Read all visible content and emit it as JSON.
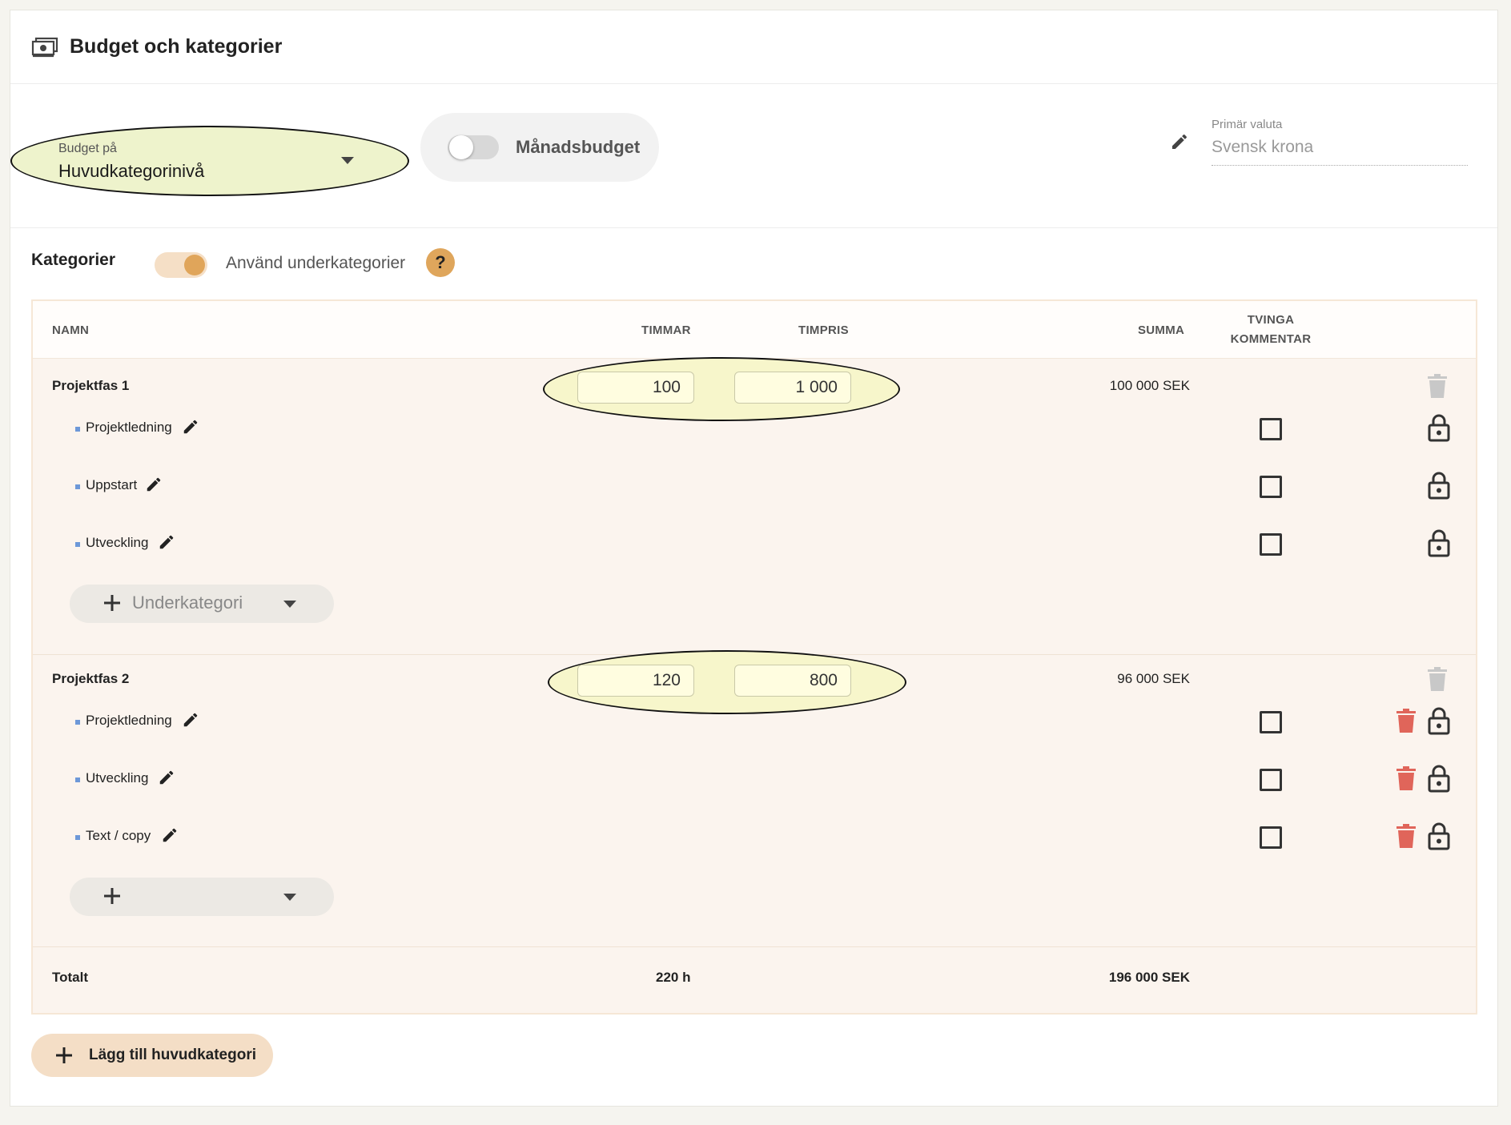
{
  "header": {
    "title": "Budget och kategorier",
    "icon": "money-icon"
  },
  "settings": {
    "budget_on_label": "Budget på",
    "budget_on_value": "Huvudkategorinivå",
    "monthly_budget_label": "Månadsbudget",
    "monthly_budget_enabled": false,
    "currency_label": "Primär valuta",
    "currency_value": "Svensk krona"
  },
  "categories": {
    "title": "Kategorier",
    "use_subcategories_label": "Använd underkategorier",
    "use_subcategories_enabled": true,
    "help_symbol": "?"
  },
  "table": {
    "headers": {
      "name": "NAMN",
      "hours": "TIMMAR",
      "rate": "TIMPRIS",
      "sum": "SUMMA",
      "force_comment_1": "TVINGA",
      "force_comment_2": "KOMMENTAR"
    },
    "groups": [
      {
        "name": "Projektfas 1",
        "hours": "100",
        "rate": "1 000",
        "sum": "100 000 SEK",
        "subcategories": [
          {
            "name": "Projektledning",
            "force_comment": false,
            "deletable": false
          },
          {
            "name": "Uppstart",
            "force_comment": false,
            "deletable": false
          },
          {
            "name": "Utveckling",
            "force_comment": false,
            "deletable": false
          }
        ],
        "add_sub_label": "Underkategori"
      },
      {
        "name": "Projektfas 2",
        "hours": "120",
        "rate": "800",
        "sum": "96 000 SEK",
        "subcategories": [
          {
            "name": "Projektledning",
            "force_comment": false,
            "deletable": true
          },
          {
            "name": "Utveckling",
            "force_comment": false,
            "deletable": true
          },
          {
            "name": "Text / copy",
            "force_comment": false,
            "deletable": true
          }
        ],
        "add_sub_label": ""
      }
    ],
    "total": {
      "label": "Totalt",
      "hours": "220 h",
      "sum": "196 000 SEK"
    }
  },
  "add_main_label": "Lägg till huvudkategori",
  "colors": {
    "accent": "#e0a55a",
    "accent_light": "#f4dec6",
    "table_bg": "#fbf4ee",
    "delete_red": "#e0655a",
    "bullet_blue": "#6d98d8"
  }
}
